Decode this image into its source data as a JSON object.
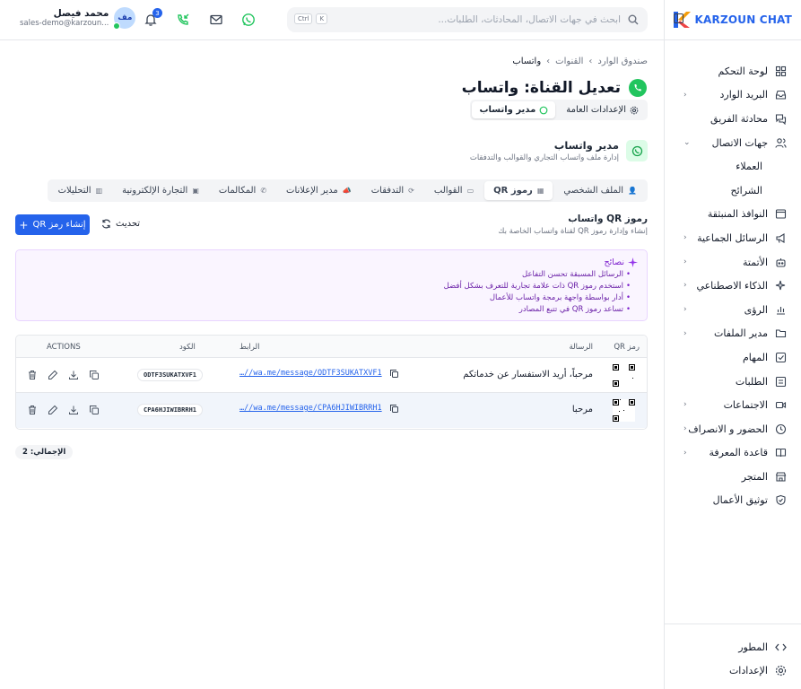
{
  "app": {
    "name": "KARZOUN CHAT"
  },
  "search": {
    "placeholder": "ابحث في جهات الاتصال، المحادثات، الطلبات...",
    "kbd_ctrl": "Ctrl",
    "kbd_k": "K"
  },
  "user": {
    "name": "محمد فيصل",
    "email": "sales-demo@karzoun...",
    "initials": "مف",
    "notifications": "3"
  },
  "sidebar": {
    "items": [
      {
        "label": "لوحة التحكم",
        "icon": "grid-icon",
        "chevron": false
      },
      {
        "label": "البريد الوارد",
        "icon": "inbox-icon",
        "chevron": true
      },
      {
        "label": "محادثة الفريق",
        "icon": "chat-icon",
        "chevron": false
      },
      {
        "label": "جهات الاتصال",
        "icon": "users-icon",
        "chevron": true,
        "expanded": true
      },
      {
        "label": "العملاء",
        "sub": true
      },
      {
        "label": "الشرائح",
        "sub": true
      },
      {
        "label": "النوافذ المنبثقة",
        "icon": "window-icon",
        "chevron": false
      },
      {
        "label": "الرسائل الجماعية",
        "icon": "megaphone-icon",
        "chevron": true
      },
      {
        "label": "الأتمتة",
        "icon": "bot-icon",
        "chevron": true
      },
      {
        "label": "الذكاء الاصطناعي",
        "icon": "sparkles-icon",
        "chevron": true
      },
      {
        "label": "الرؤى",
        "icon": "bar-chart-icon",
        "chevron": true
      },
      {
        "label": "مدير الملفات",
        "icon": "folder-icon",
        "chevron": true
      },
      {
        "label": "المهام",
        "icon": "checkbox-icon",
        "chevron": false
      },
      {
        "label": "الطلبات",
        "icon": "list-icon",
        "chevron": false
      },
      {
        "label": "الاجتماعات",
        "icon": "video-icon",
        "chevron": true
      },
      {
        "label": "الحضور و الانصراف",
        "icon": "clock-icon",
        "chevron": true
      },
      {
        "label": "قاعدة المعرفة",
        "icon": "book-icon",
        "chevron": true
      },
      {
        "label": "المتجر",
        "icon": "store-icon",
        "chevron": false
      },
      {
        "label": "توثيق الأعمال",
        "icon": "shield-check-icon",
        "chevron": false
      }
    ],
    "bottom": [
      {
        "label": "المطور",
        "icon": "code-icon"
      },
      {
        "label": "الإعدادات",
        "icon": "settings-icon"
      }
    ]
  },
  "breadcrumb": {
    "a": "صندوق الوارد",
    "b": "القنوات",
    "c": "واتساب"
  },
  "page": {
    "title": "تعديل القناة: واتساب"
  },
  "segments": {
    "general": "الإعدادات العامة",
    "manager": "مدير واتساب"
  },
  "manager": {
    "title": "مدير واتساب",
    "desc": "إدارة ملف واتساب التجاري والقوالب والتدفقات"
  },
  "tabs": [
    {
      "label": "الملف الشخصي",
      "active": false
    },
    {
      "label": "رموز QR",
      "active": true
    },
    {
      "label": "القوالب",
      "active": false
    },
    {
      "label": "التدفقات",
      "active": false
    },
    {
      "label": "مدير الإعلانات",
      "active": false
    },
    {
      "label": "المكالمات",
      "active": false
    },
    {
      "label": "التجارة الإلكترونية",
      "active": false
    },
    {
      "label": "التحليلات",
      "active": false
    }
  ],
  "section": {
    "title": "رموز QR واتساب",
    "desc": "إنشاء وإدارة رموز QR لقناة واتساب الخاصة بك",
    "refresh": "تحديث",
    "create": "إنشاء رمز QR"
  },
  "tips": {
    "title": "نصائح",
    "items": [
      "الرسائل المسبقة تحسن التفاعل",
      "استخدم رموز QR ذات علامة تجارية للتعرف بشكل أفضل",
      "أدار بواسطة واجهة برمجة واتساب للأعمال",
      "تساعد رموز QR في تتبع المصادر"
    ]
  },
  "table": {
    "headers": {
      "qr": "رمز QR",
      "message": "الرسالة",
      "link": "الرابط",
      "code": "الكود",
      "actions": "ACTIONS"
    },
    "rows": [
      {
        "message": "مرحباً، أريد الاستفسار عن خدماتكم",
        "link": "https://wa.me/message/ODTF3SUKATXVF1",
        "link_display": "…//wa.me/message/ODTF3SUKATXVF1",
        "code": "ODTF3SUKATXVF1"
      },
      {
        "message": "مرحبا",
        "link": "https://wa.me/message/CPA6HJIWIBRRH1",
        "link_display": "…//wa.me/message/CPA6HJIWIBRRH1",
        "code": "CPA6HJIWIBRRH1"
      }
    ],
    "total": "الإجمالي: 2"
  },
  "colors": {
    "accent": "#2563eb",
    "whatsapp": "#22c55e",
    "tips_bg": "#faf5ff"
  }
}
